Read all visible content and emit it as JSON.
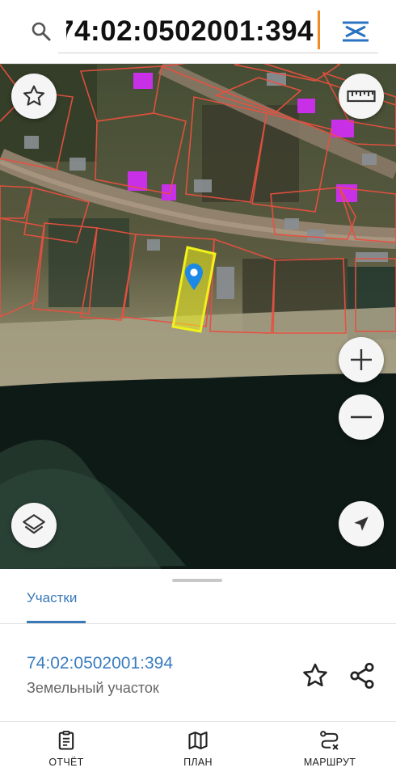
{
  "search": {
    "query": "74:02:0502001:394",
    "search_icon": "search-icon",
    "clear_icon": "clear-search-icon"
  },
  "map": {
    "buttons": {
      "favorite": "star-outline-icon",
      "ruler": "ruler-icon",
      "zoom_in": "plus-icon",
      "zoom_out": "minus-icon",
      "layers": "layers-icon",
      "locate": "navigation-arrow-icon"
    },
    "marker": "map-pin-icon",
    "colors": {
      "parcel_border": "#e85040",
      "selected_parcel": "#f1f11b",
      "marker": "#1e88e5",
      "building": "#c830e8"
    }
  },
  "sheet": {
    "tab_label": "Участки",
    "cadastral_number": "74:02:0502001:394",
    "parcel_type": "Земельный участок",
    "favorite_icon": "star-outline-icon",
    "share_icon": "share-icon"
  },
  "bottom_nav": [
    {
      "label": "ОТЧЁТ",
      "icon": "report-clipboard-icon"
    },
    {
      "label": "ПЛАН",
      "icon": "map-plan-icon"
    },
    {
      "label": "МАРШРУТ",
      "icon": "route-icon"
    }
  ],
  "colors": {
    "accent": "#3a78b6",
    "cursor": "#f08a24"
  }
}
